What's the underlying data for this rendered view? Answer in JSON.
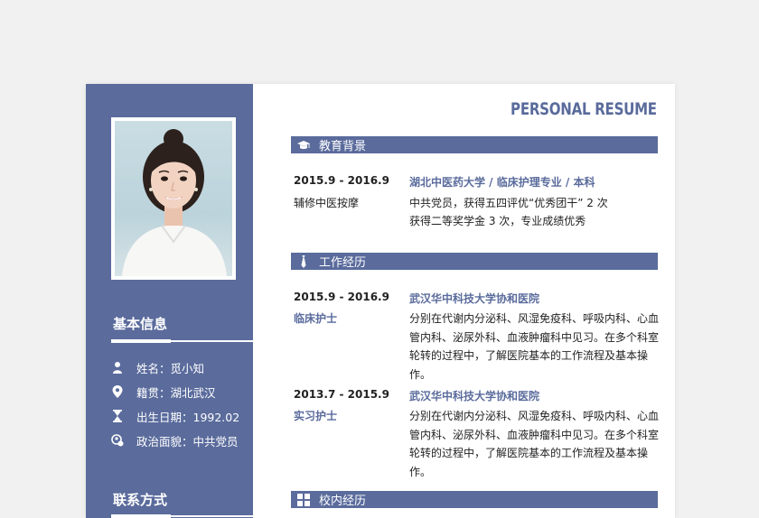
{
  "header": {
    "title": "PERSONAL RESUME"
  },
  "sidebar": {
    "basic_heading": "基本信息",
    "contact_heading": "联系方式",
    "info": [
      {
        "icon": "person-icon",
        "label": "姓名：觅小知"
      },
      {
        "icon": "location-pin-icon",
        "label": "籍贯：湖北武汉"
      },
      {
        "icon": "hourglass-icon",
        "label": "出生日期：1992.02"
      },
      {
        "icon": "politics-icon",
        "label": "政治面貌：中共党员"
      }
    ]
  },
  "education": {
    "heading": "教育背景",
    "date": "2015.9 - 2016.9",
    "sub": "辅修中医按摩",
    "school": "湖北中医药大学 / 临床护理专业 / 本科",
    "line1": "中共党员，获得五四评优“优秀团干” 2 次",
    "line2": "获得二等奖学金 3 次，专业成绩优秀"
  },
  "work": {
    "heading": "工作经历",
    "entries": [
      {
        "date": "2015.9 - 2016.9",
        "role": "临床护士",
        "org": "武汉华中科技大学协和医院",
        "desc": "分别在代谢内分泌科、风湿免疫科、呼吸内科、心血管内科、泌尿外科、血液肿瘤科中见习。在多个科室轮转的过程中，了解医院基本的工作流程及基本操作。"
      },
      {
        "date": "2013.7 - 2015.9",
        "role": "实习护士",
        "org": "武汉华中科技大学协和医院",
        "desc": "分别在代谢内分泌科、风湿免疫科、呼吸内科、心血管内科、泌尿外科、血液肿瘤科中见习。在多个科室轮转的过程中，了解医院基本的工作流程及基本操作。"
      }
    ]
  },
  "campus": {
    "heading": "校内经历"
  },
  "colors": {
    "accent": "#5a6b9c",
    "page": "#ffffff",
    "background": "#f1f1f1"
  }
}
